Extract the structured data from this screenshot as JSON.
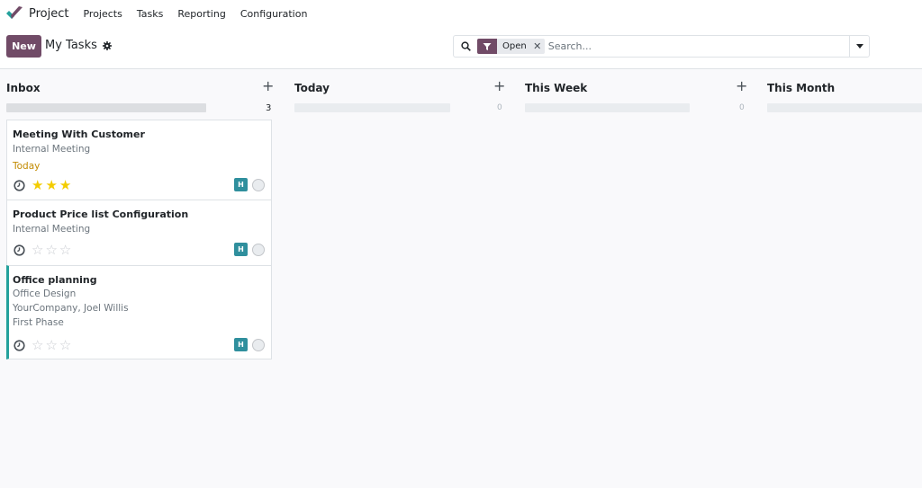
{
  "navbar": {
    "app_name": "Project",
    "menu": [
      "Projects",
      "Tasks",
      "Reporting",
      "Configuration"
    ]
  },
  "control_panel": {
    "new_label": "New",
    "title": "My Tasks",
    "search": {
      "facet_value": "Open",
      "placeholder": "Search..."
    }
  },
  "kanban": {
    "columns": [
      {
        "title": "Inbox",
        "count": "3"
      },
      {
        "title": "Today",
        "count": "0"
      },
      {
        "title": "This Week",
        "count": "0"
      },
      {
        "title": "This Month",
        "count": ""
      }
    ],
    "cards": [
      {
        "title": "Meeting With Customer",
        "lines": [
          "Internal Meeting"
        ],
        "deadline": "Today",
        "stars": 3,
        "avatar": "H"
      },
      {
        "title": "Product Price list Configuration",
        "lines": [
          "Internal Meeting"
        ],
        "deadline": "",
        "stars": 0,
        "avatar": "H"
      },
      {
        "title": "Office planning",
        "lines": [
          "Office Design",
          "YourCompany, Joel Willis",
          "First Phase"
        ],
        "deadline": "",
        "stars": 0,
        "avatar": "H"
      }
    ]
  },
  "colors": {
    "brand": "#714b67",
    "avatar": "#2f8f9d",
    "star_on": "#f3cc00",
    "deadline": "#c28a00",
    "card_accent": "#24a19c"
  }
}
